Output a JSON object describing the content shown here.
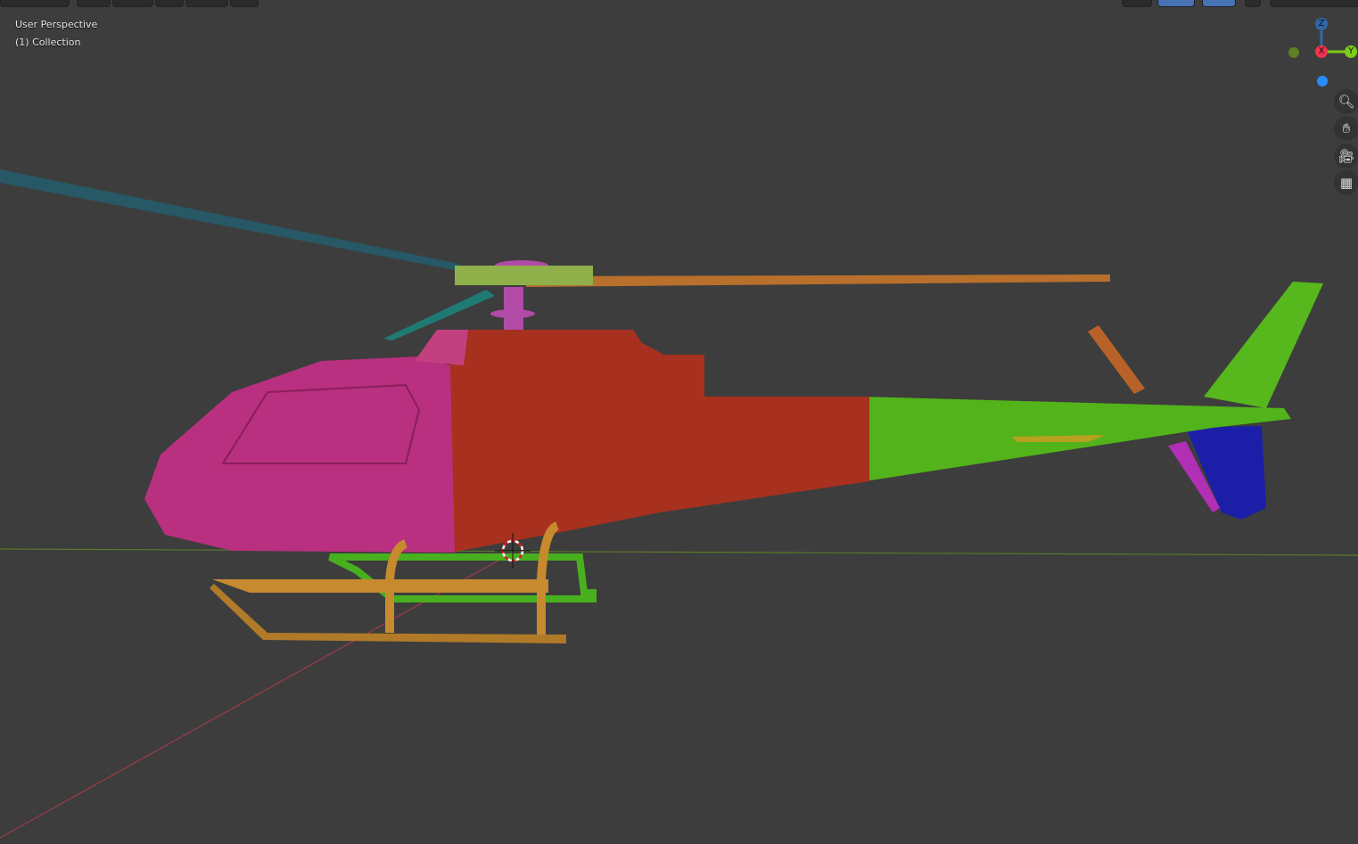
{
  "viewport": {
    "view_name": "User Perspective",
    "collection": "(1) Collection"
  },
  "gizmo": {
    "axes": [
      {
        "label": "Z",
        "color": "#2f68a8"
      },
      {
        "label": "X",
        "color": "#f0334f"
      },
      {
        "label": "Y",
        "color": "#7dcc1a"
      }
    ],
    "neg_x_color": "#5d8025",
    "neg_z_color": "#2a8cff"
  },
  "nav_buttons": [
    {
      "name": "zoom",
      "icon": "zoom-in-icon"
    },
    {
      "name": "pan",
      "icon": "hand-icon"
    },
    {
      "name": "camera",
      "icon": "camera-icon"
    },
    {
      "name": "ortho",
      "icon": "grid-icon"
    }
  ],
  "colors": {
    "background": "#3d3d3d",
    "cockpit": "#b8307f",
    "fuselage": "#a8301e",
    "tail_boom": "#52b41a",
    "skids": "#c88a2e",
    "fin_blue": "#1c1ea8",
    "blade_teal": "#275865",
    "blade_orange": "#b8702c"
  }
}
